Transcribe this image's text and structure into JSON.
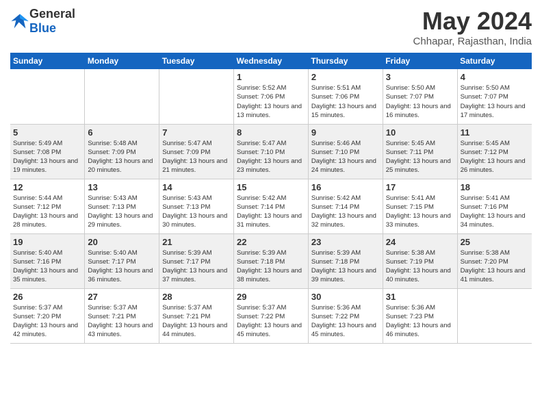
{
  "logo": {
    "general": "General",
    "blue": "Blue"
  },
  "title": "May 2024",
  "subtitle": "Chhapar, Rajasthan, India",
  "weekdays": [
    "Sunday",
    "Monday",
    "Tuesday",
    "Wednesday",
    "Thursday",
    "Friday",
    "Saturday"
  ],
  "weeks": [
    [
      {
        "day": "",
        "info": ""
      },
      {
        "day": "",
        "info": ""
      },
      {
        "day": "",
        "info": ""
      },
      {
        "day": "1",
        "info": "Sunrise: 5:52 AM\nSunset: 7:06 PM\nDaylight: 13 hours and 13 minutes."
      },
      {
        "day": "2",
        "info": "Sunrise: 5:51 AM\nSunset: 7:06 PM\nDaylight: 13 hours and 15 minutes."
      },
      {
        "day": "3",
        "info": "Sunrise: 5:50 AM\nSunset: 7:07 PM\nDaylight: 13 hours and 16 minutes."
      },
      {
        "day": "4",
        "info": "Sunrise: 5:50 AM\nSunset: 7:07 PM\nDaylight: 13 hours and 17 minutes."
      }
    ],
    [
      {
        "day": "5",
        "info": "Sunrise: 5:49 AM\nSunset: 7:08 PM\nDaylight: 13 hours and 19 minutes."
      },
      {
        "day": "6",
        "info": "Sunrise: 5:48 AM\nSunset: 7:09 PM\nDaylight: 13 hours and 20 minutes."
      },
      {
        "day": "7",
        "info": "Sunrise: 5:47 AM\nSunset: 7:09 PM\nDaylight: 13 hours and 21 minutes."
      },
      {
        "day": "8",
        "info": "Sunrise: 5:47 AM\nSunset: 7:10 PM\nDaylight: 13 hours and 23 minutes."
      },
      {
        "day": "9",
        "info": "Sunrise: 5:46 AM\nSunset: 7:10 PM\nDaylight: 13 hours and 24 minutes."
      },
      {
        "day": "10",
        "info": "Sunrise: 5:45 AM\nSunset: 7:11 PM\nDaylight: 13 hours and 25 minutes."
      },
      {
        "day": "11",
        "info": "Sunrise: 5:45 AM\nSunset: 7:12 PM\nDaylight: 13 hours and 26 minutes."
      }
    ],
    [
      {
        "day": "12",
        "info": "Sunrise: 5:44 AM\nSunset: 7:12 PM\nDaylight: 13 hours and 28 minutes."
      },
      {
        "day": "13",
        "info": "Sunrise: 5:43 AM\nSunset: 7:13 PM\nDaylight: 13 hours and 29 minutes."
      },
      {
        "day": "14",
        "info": "Sunrise: 5:43 AM\nSunset: 7:13 PM\nDaylight: 13 hours and 30 minutes."
      },
      {
        "day": "15",
        "info": "Sunrise: 5:42 AM\nSunset: 7:14 PM\nDaylight: 13 hours and 31 minutes."
      },
      {
        "day": "16",
        "info": "Sunrise: 5:42 AM\nSunset: 7:14 PM\nDaylight: 13 hours and 32 minutes."
      },
      {
        "day": "17",
        "info": "Sunrise: 5:41 AM\nSunset: 7:15 PM\nDaylight: 13 hours and 33 minutes."
      },
      {
        "day": "18",
        "info": "Sunrise: 5:41 AM\nSunset: 7:16 PM\nDaylight: 13 hours and 34 minutes."
      }
    ],
    [
      {
        "day": "19",
        "info": "Sunrise: 5:40 AM\nSunset: 7:16 PM\nDaylight: 13 hours and 35 minutes."
      },
      {
        "day": "20",
        "info": "Sunrise: 5:40 AM\nSunset: 7:17 PM\nDaylight: 13 hours and 36 minutes."
      },
      {
        "day": "21",
        "info": "Sunrise: 5:39 AM\nSunset: 7:17 PM\nDaylight: 13 hours and 37 minutes."
      },
      {
        "day": "22",
        "info": "Sunrise: 5:39 AM\nSunset: 7:18 PM\nDaylight: 13 hours and 38 minutes."
      },
      {
        "day": "23",
        "info": "Sunrise: 5:39 AM\nSunset: 7:18 PM\nDaylight: 13 hours and 39 minutes."
      },
      {
        "day": "24",
        "info": "Sunrise: 5:38 AM\nSunset: 7:19 PM\nDaylight: 13 hours and 40 minutes."
      },
      {
        "day": "25",
        "info": "Sunrise: 5:38 AM\nSunset: 7:20 PM\nDaylight: 13 hours and 41 minutes."
      }
    ],
    [
      {
        "day": "26",
        "info": "Sunrise: 5:37 AM\nSunset: 7:20 PM\nDaylight: 13 hours and 42 minutes."
      },
      {
        "day": "27",
        "info": "Sunrise: 5:37 AM\nSunset: 7:21 PM\nDaylight: 13 hours and 43 minutes."
      },
      {
        "day": "28",
        "info": "Sunrise: 5:37 AM\nSunset: 7:21 PM\nDaylight: 13 hours and 44 minutes."
      },
      {
        "day": "29",
        "info": "Sunrise: 5:37 AM\nSunset: 7:22 PM\nDaylight: 13 hours and 45 minutes."
      },
      {
        "day": "30",
        "info": "Sunrise: 5:36 AM\nSunset: 7:22 PM\nDaylight: 13 hours and 45 minutes."
      },
      {
        "day": "31",
        "info": "Sunrise: 5:36 AM\nSunset: 7:23 PM\nDaylight: 13 hours and 46 minutes."
      },
      {
        "day": "",
        "info": ""
      }
    ]
  ]
}
